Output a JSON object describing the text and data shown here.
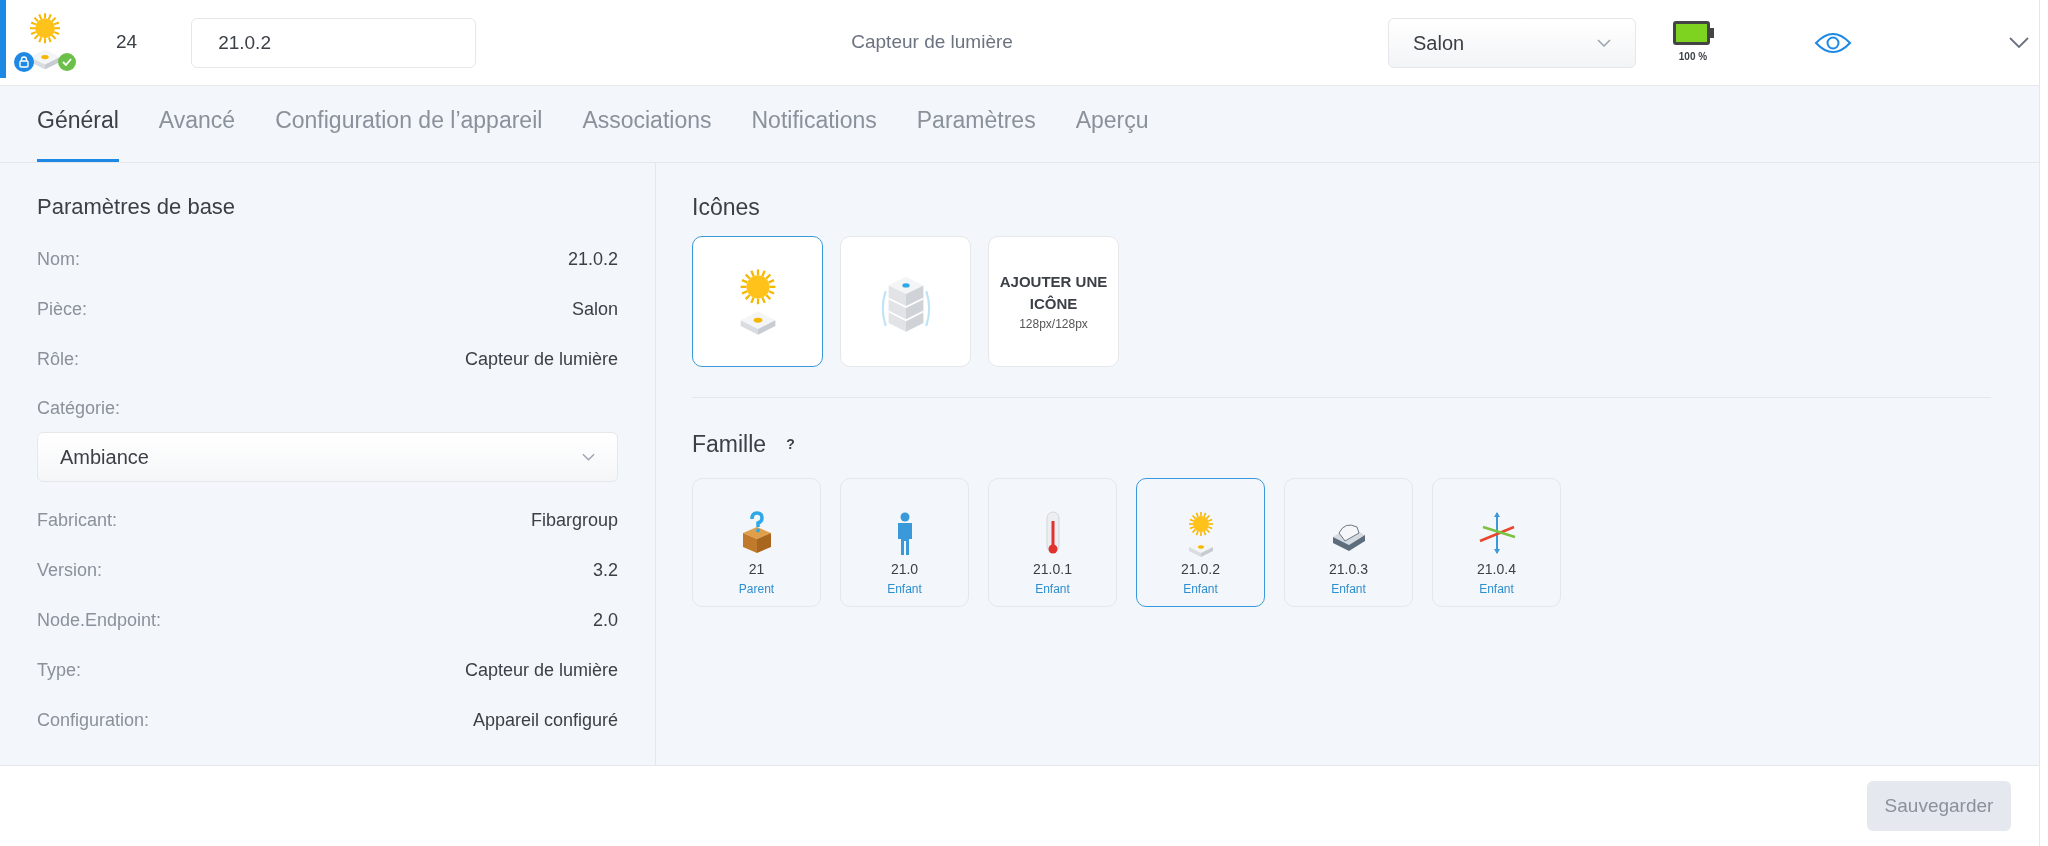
{
  "header": {
    "locked": true,
    "configured": true,
    "id": "24",
    "name_value": "21.0.2",
    "role": "Capteur de lumière",
    "room": "Salon",
    "battery": {
      "level": 1,
      "reading": "100 %"
    },
    "visible": true
  },
  "tabs": [
    {
      "label": "Général",
      "selected": true
    },
    {
      "label": "Avancé",
      "selected": false
    },
    {
      "label": "Configuration de l’appareil",
      "selected": false
    },
    {
      "label": "Associations",
      "selected": false
    },
    {
      "label": "Notifications",
      "selected": false
    },
    {
      "label": "Paramètres",
      "selected": false
    },
    {
      "label": "Aperçu",
      "selected": false
    }
  ],
  "basic": {
    "title": "Paramètres de base",
    "rows": [
      {
        "kind": "row",
        "label": "Nom:",
        "value": "21.0.2"
      },
      {
        "kind": "row",
        "label": "Pièce:",
        "value": "Salon"
      },
      {
        "kind": "row",
        "label": "Rôle:",
        "value": "Capteur de lumière"
      },
      {
        "kind": "select",
        "label": "Catégorie:",
        "value": "Ambiance"
      },
      {
        "kind": "row",
        "label": "Fabricant:",
        "value": "Fibargroup"
      },
      {
        "kind": "row",
        "label": "Version:",
        "value": "3.2"
      },
      {
        "kind": "row",
        "label": "Node.Endpoint:",
        "value": "2.0"
      },
      {
        "kind": "row",
        "label": "Type:",
        "value": "Capteur de lumière"
      },
      {
        "kind": "row",
        "label": "Configuration:",
        "value": "Appareil configuré"
      }
    ]
  },
  "icons": {
    "title": "Icônes",
    "items": [
      {
        "kind": "light",
        "selected": true
      },
      {
        "kind": "hub",
        "selected": false
      }
    ],
    "add": {
      "title": "AJOUTER UNE ICÔNE",
      "subtitle": "128px/128px"
    }
  },
  "family": {
    "title": "Famille",
    "help": "?",
    "items": [
      {
        "kind": "unknown",
        "id": "21",
        "relation": "Parent",
        "selected": false
      },
      {
        "kind": "person",
        "id": "21.0",
        "relation": "Enfant",
        "selected": false
      },
      {
        "kind": "thermometer",
        "id": "21.0.1",
        "relation": "Enfant",
        "selected": false
      },
      {
        "kind": "light",
        "id": "21.0.2",
        "relation": "Enfant",
        "selected": true
      },
      {
        "kind": "meter",
        "id": "21.0.3",
        "relation": "Enfant",
        "selected": false
      },
      {
        "kind": "axes",
        "id": "21.0.4",
        "relation": "Enfant",
        "selected": false
      }
    ]
  },
  "save_button": {
    "label": "Sauvegarder",
    "disabled": true
  }
}
